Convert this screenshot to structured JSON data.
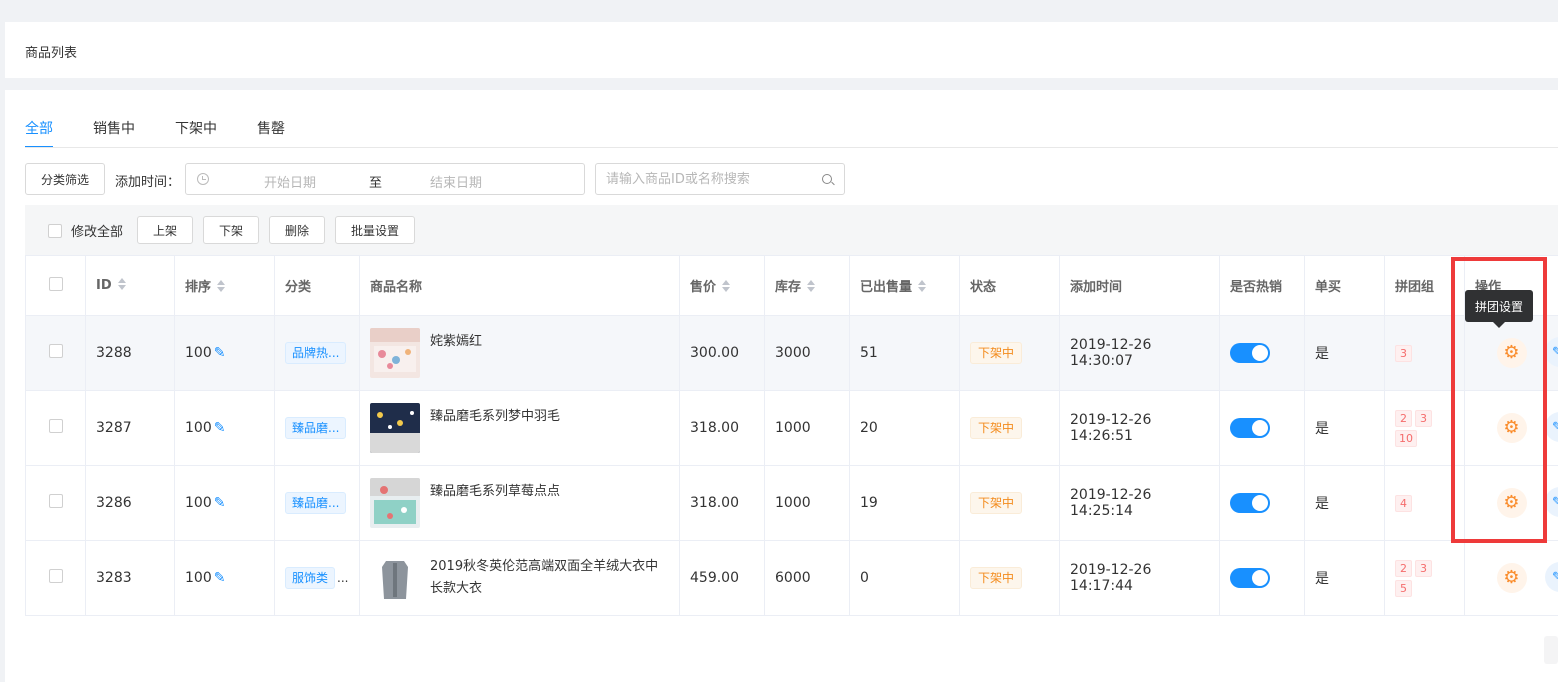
{
  "page": {
    "title": "商品列表"
  },
  "tabs": [
    {
      "label": "全部",
      "active": true
    },
    {
      "label": "销售中",
      "active": false
    },
    {
      "label": "下架中",
      "active": false
    },
    {
      "label": "售罄",
      "active": false
    }
  ],
  "filters": {
    "category_button": "分类筛选",
    "time_label": "添加时间：",
    "start_placeholder": "开始日期",
    "range_separator": "至",
    "end_placeholder": "结束日期",
    "search_placeholder": "请输入商品ID或名称搜索"
  },
  "bulk": {
    "select_all_label": "修改全部",
    "on_shelf": "上架",
    "off_shelf": "下架",
    "delete": "删除",
    "batch_settings": "批量设置"
  },
  "table": {
    "headers": {
      "id": "ID",
      "sort": "排序",
      "category": "分类",
      "name": "商品名称",
      "price": "售价",
      "stock": "库存",
      "sold": "已出售量",
      "status": "状态",
      "added": "添加时间",
      "hot": "是否热销",
      "single": "单买",
      "groups": "拼团组",
      "action": "操作"
    },
    "rows": [
      {
        "id": "3288",
        "sort": "100",
        "category": "品牌热...",
        "category_more": "",
        "name": "姹紫嫣红",
        "price": "300.00",
        "stock": "3000",
        "sold": "51",
        "status": "下架中",
        "added": "2019-12-26 14:30:07",
        "hot": true,
        "single": "是",
        "groups": [
          "3"
        ]
      },
      {
        "id": "3287",
        "sort": "100",
        "category": "臻品磨...",
        "category_more": "",
        "name": "臻品磨毛系列梦中羽毛",
        "price": "318.00",
        "stock": "1000",
        "sold": "20",
        "status": "下架中",
        "added": "2019-12-26 14:26:51",
        "hot": true,
        "single": "是",
        "groups": [
          "2",
          "3",
          "10"
        ]
      },
      {
        "id": "3286",
        "sort": "100",
        "category": "臻品磨...",
        "category_more": "",
        "name": "臻品磨毛系列草莓点点",
        "price": "318.00",
        "stock": "1000",
        "sold": "19",
        "status": "下架中",
        "added": "2019-12-26 14:25:14",
        "hot": true,
        "single": "是",
        "groups": [
          "4"
        ]
      },
      {
        "id": "3283",
        "sort": "100",
        "category": "服饰类",
        "category_more": "...",
        "name": "2019秋冬英伦范高端双面全羊绒大衣中长款大衣",
        "price": "459.00",
        "stock": "6000",
        "sold": "0",
        "status": "下架中",
        "added": "2019-12-26 14:17:44",
        "hot": true,
        "single": "是",
        "groups": [
          "2",
          "3",
          "5"
        ]
      }
    ]
  },
  "tooltip": {
    "text": "拼团设置"
  },
  "icons": {
    "gear": "gear-icon",
    "pencil": "pencil-icon",
    "edit": "edit-icon",
    "clock": "clock-icon",
    "search": "search-icon"
  },
  "colors": {
    "primary": "#1890ff",
    "status_offline": "#f38b1c",
    "group_tag": "#f56c6c",
    "highlight": "#ee3a3a",
    "gear": "#fa8c2b"
  }
}
